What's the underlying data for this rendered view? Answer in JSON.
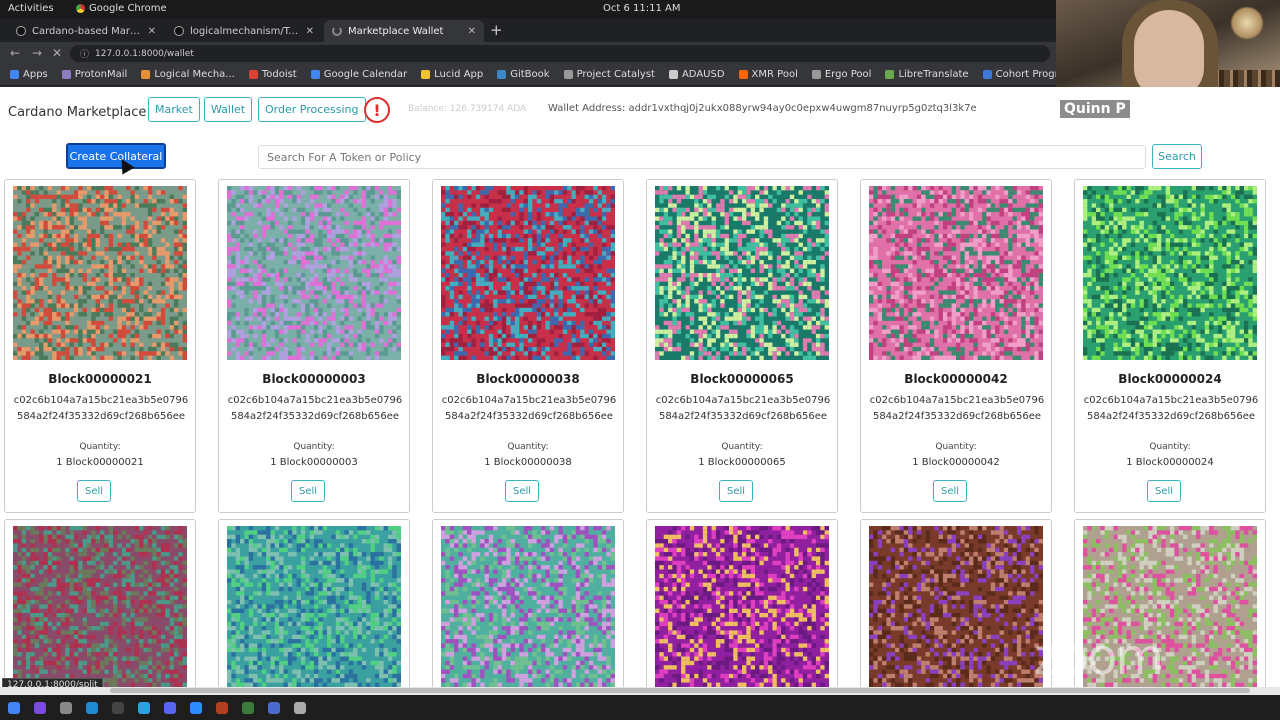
{
  "topbar": {
    "activities": "Activities",
    "app": "Google Chrome",
    "clock": "Oct 6  11:11 AM"
  },
  "tabs": [
    {
      "label": "Cardano-based Marketpla",
      "active": false
    },
    {
      "label": "logicalmechanism/Token",
      "active": false
    },
    {
      "label": "Marketplace Wallet",
      "active": true
    }
  ],
  "address": {
    "url": "127.0.0.1:8000/wallet"
  },
  "bookmarks": [
    {
      "label": "Apps",
      "color": "#4285f4"
    },
    {
      "label": "ProtonMail",
      "color": "#8e7cc3"
    },
    {
      "label": "Logical Mecha...",
      "color": "#e69138"
    },
    {
      "label": "Todoist",
      "color": "#db4035"
    },
    {
      "label": "Google Calendar",
      "color": "#4285f4"
    },
    {
      "label": "Lucid App",
      "color": "#f1c232"
    },
    {
      "label": "GitBook",
      "color": "#3d85c6"
    },
    {
      "label": "Project Catalyst",
      "color": "#999999"
    },
    {
      "label": "ADAUSD",
      "color": "#cccccc"
    },
    {
      "label": "XMR Pool",
      "color": "#ff6600"
    },
    {
      "label": "Ergo Pool",
      "color": "#999999"
    },
    {
      "label": "LibreTranslate",
      "color": "#6aa84f"
    },
    {
      "label": "Cohort Progre...",
      "color": "#3c78d8"
    }
  ],
  "webcam": {
    "name": "Quinn P"
  },
  "header": {
    "brand": "Cardano Marketplace",
    "nav": [
      "Market",
      "Wallet",
      "Order Processing"
    ],
    "alert_symbol": "!",
    "balance": "Balance: 126.739174 ADA",
    "wallet_address": "Wallet Address: addr1vxthqj0j2ukx088yrw94ay0c0epxw4uwgm87nuyrp5g0ztq3l3k7e"
  },
  "toolbar": {
    "create_collateral": "Create Collateral",
    "search_placeholder": "Search For A Token or Policy",
    "search_label": "Search"
  },
  "cards": [
    {
      "name": "Block00000021",
      "policy": "c02c6b104a7a15bc21ea3b5e0796584a2f24f35332d69cf268b656ee",
      "quantity_label": "Quantity:",
      "quantity": "1 Block00000021",
      "sell": "Sell",
      "palette": [
        "#7a9a8a",
        "#d44a3a",
        "#4a7a5a",
        "#e89a6a"
      ]
    },
    {
      "name": "Block00000003",
      "policy": "c02c6b104a7a15bc21ea3b5e0796584a2f24f35332d69cf268b656ee",
      "quantity_label": "Quantity:",
      "quantity": "1 Block00000003",
      "sell": "Sell",
      "palette": [
        "#7ab0a8",
        "#e070d8",
        "#b0a0e0",
        "#5a9a90"
      ]
    },
    {
      "name": "Block00000038",
      "policy": "c02c6b104a7a15bc21ea3b5e0796584a2f24f35332d69cf268b656ee",
      "quantity_label": "Quantity:",
      "quantity": "1 Block00000038",
      "sell": "Sell",
      "palette": [
        "#c8304a",
        "#3a6ab0",
        "#a02040",
        "#40b0c0"
      ]
    },
    {
      "name": "Block00000065",
      "policy": "c02c6b104a7a15bc21ea3b5e0796584a2f24f35332d69cf268b656ee",
      "quantity_label": "Quantity:",
      "quantity": "1 Block00000065",
      "sell": "Sell",
      "palette": [
        "#1a7a6a",
        "#e07ab0",
        "#40c0a0",
        "#d0f0a0"
      ]
    },
    {
      "name": "Block00000042",
      "policy": "c02c6b104a7a15bc21ea3b5e0796584a2f24f35332d69cf268b656ee",
      "quantity_label": "Quantity:",
      "quantity": "1 Block00000042",
      "sell": "Sell",
      "palette": [
        "#e070a8",
        "#3a8a70",
        "#c04080",
        "#f0a0c8"
      ]
    },
    {
      "name": "Block00000024",
      "policy": "c02c6b104a7a15bc21ea3b5e0796584a2f24f35332d69cf268b656ee",
      "quantity_label": "Quantity:",
      "quantity": "1 Block00000024",
      "sell": "Sell",
      "palette": [
        "#2aa070",
        "#70e050",
        "#1a7050",
        "#b0f080"
      ]
    }
  ],
  "cards_row2": [
    {
      "palette": [
        "#8a4a6a",
        "#4a9a8a",
        "#b03050",
        "#6a7a5a"
      ]
    },
    {
      "palette": [
        "#3aa0a0",
        "#50d080",
        "#2a70a0",
        "#80c0b0"
      ]
    },
    {
      "palette": [
        "#50b0a0",
        "#a050c0",
        "#70c090",
        "#d0a0e0"
      ]
    },
    {
      "palette": [
        "#9020a0",
        "#e040c0",
        "#6a1a80",
        "#f0c060"
      ]
    },
    {
      "palette": [
        "#7a3a2a",
        "#c08070",
        "#5a2a1a",
        "#8a40c0"
      ]
    },
    {
      "palette": [
        "#b0a090",
        "#e050a0",
        "#8ac060",
        "#d0d0c0"
      ]
    }
  ],
  "statusbar": {
    "url": "127.0.0.1:8000/split"
  },
  "watermark": {
    "text": "zoom"
  }
}
